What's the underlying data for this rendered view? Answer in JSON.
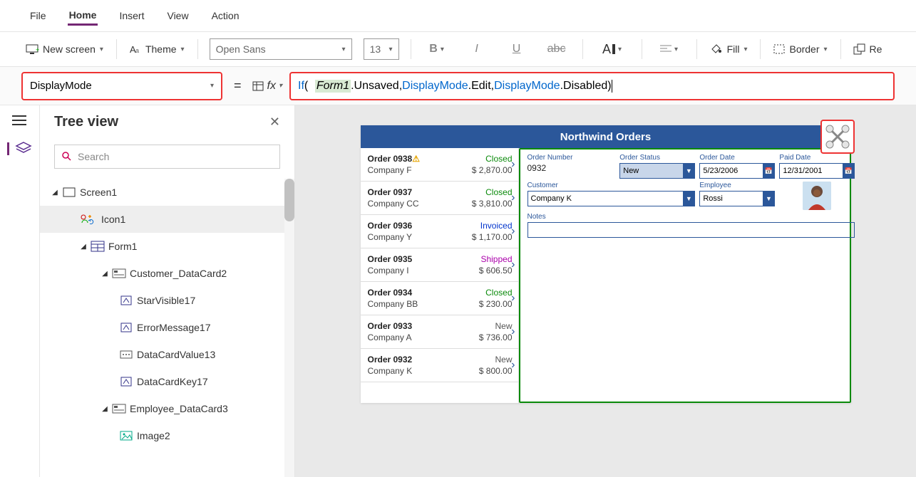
{
  "menu": {
    "file": "File",
    "home": "Home",
    "insert": "Insert",
    "view": "View",
    "action": "Action"
  },
  "ribbon": {
    "new_screen": "New screen",
    "theme": "Theme",
    "font": "Open Sans",
    "size": "13",
    "fill": "Fill",
    "border": "Border",
    "re": "Re"
  },
  "formula": {
    "property": "DisplayMode",
    "tokens": {
      "if": "If",
      "lparen": "(",
      "form1": "Form1",
      "dot_unsaved": ".Unsaved, ",
      "dm1": "DisplayMode",
      "edit": ".Edit, ",
      "dm2": "DisplayMode",
      "disabled": ".Disabled ",
      "rparen": ")"
    }
  },
  "tree": {
    "title": "Tree view",
    "search_placeholder": "Search",
    "items": {
      "screen1": "Screen1",
      "icon1": "Icon1",
      "form1": "Form1",
      "customer_card": "Customer_DataCard2",
      "starvisible": "StarVisible17",
      "errormsg": "ErrorMessage17",
      "dcv": "DataCardValue13",
      "dck": "DataCardKey17",
      "employee_card": "Employee_DataCard3",
      "image2": "Image2"
    }
  },
  "app": {
    "title": "Northwind Orders",
    "orders": [
      {
        "id": "Order 0938",
        "warn": true,
        "status": "Closed",
        "status_cls": "st-closed",
        "company": "Company F",
        "amount": "$ 2,870.00"
      },
      {
        "id": "Order 0937",
        "status": "Closed",
        "status_cls": "st-closed",
        "company": "Company CC",
        "amount": "$ 3,810.00"
      },
      {
        "id": "Order 0936",
        "status": "Invoiced",
        "status_cls": "st-invoiced",
        "company": "Company Y",
        "amount": "$ 1,170.00"
      },
      {
        "id": "Order 0935",
        "status": "Shipped",
        "status_cls": "st-shipped",
        "company": "Company I",
        "amount": "$ 606.50"
      },
      {
        "id": "Order 0934",
        "status": "Closed",
        "status_cls": "st-closed",
        "company": "Company BB",
        "amount": "$ 230.00"
      },
      {
        "id": "Order 0933",
        "status": "New",
        "status_cls": "st-new",
        "company": "Company A",
        "amount": "$ 736.00"
      },
      {
        "id": "Order 0932",
        "status": "New",
        "status_cls": "st-new",
        "company": "Company K",
        "amount": "$ 800.00"
      }
    ],
    "labels": {
      "order_number": "Order Number",
      "order_status": "Order Status",
      "order_date": "Order Date",
      "paid_date": "Paid Date",
      "customer": "Customer",
      "employee": "Employee",
      "notes": "Notes"
    },
    "form": {
      "order_number": "0932",
      "order_status": "New",
      "order_date": "5/23/2006",
      "paid_date": "12/31/2001",
      "customer": "Company K",
      "employee": "Rossi"
    }
  }
}
